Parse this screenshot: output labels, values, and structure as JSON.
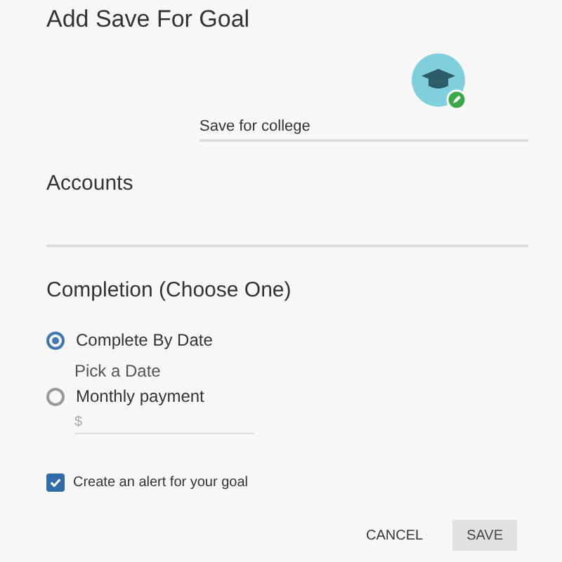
{
  "title": "Add Save For Goal",
  "goal_name": {
    "value": "Save for college"
  },
  "accounts": {
    "title": "Accounts"
  },
  "completion": {
    "title": "Completion (Choose One)",
    "options": [
      {
        "label": "Complete By Date",
        "selected": true,
        "detail": "Pick a Date"
      },
      {
        "label": "Monthly payment",
        "selected": false,
        "placeholder": "$"
      }
    ]
  },
  "alert": {
    "label": "Create an alert for your goal",
    "checked": true
  },
  "buttons": [
    {
      "label": "CANCEL",
      "kind": "text"
    },
    {
      "label": "SAVE",
      "kind": "filled"
    }
  ]
}
